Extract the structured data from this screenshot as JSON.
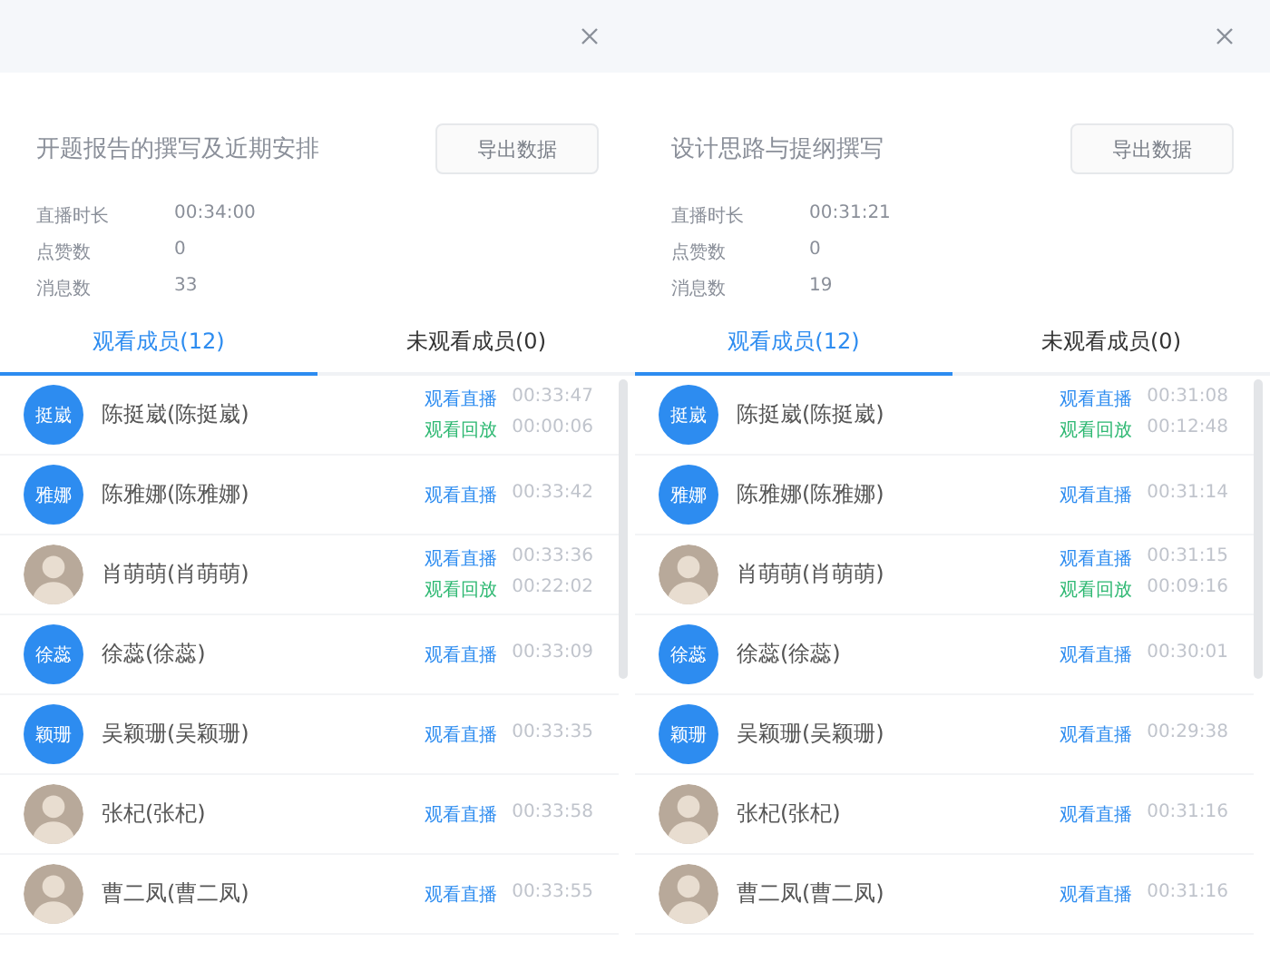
{
  "panels": [
    {
      "title": "开题报告的撰写及近期安排",
      "export_button": "导出数据",
      "stats": [
        {
          "label": "直播时长",
          "value": "00:34:00"
        },
        {
          "label": "点赞数",
          "value": "0"
        },
        {
          "label": "消息数",
          "value": "33"
        }
      ],
      "tabs": [
        {
          "label": "观看成员(12)",
          "selected": true
        },
        {
          "label": "未观看成员(0)",
          "selected": false
        }
      ],
      "members": [
        {
          "avatar": {
            "kind": "text",
            "text": "挺崴"
          },
          "name": "陈挺崴(陈挺崴)",
          "records": [
            {
              "kind": "live",
              "label": "观看直播",
              "time": "00:33:47"
            },
            {
              "kind": "replay",
              "label": "观看回放",
              "time": "00:00:06"
            }
          ]
        },
        {
          "avatar": {
            "kind": "text",
            "text": "雅娜"
          },
          "name": "陈雅娜(陈雅娜)",
          "records": [
            {
              "kind": "live",
              "label": "观看直播",
              "time": "00:33:42"
            }
          ]
        },
        {
          "avatar": {
            "kind": "photo"
          },
          "name": "肖萌萌(肖萌萌)",
          "records": [
            {
              "kind": "live",
              "label": "观看直播",
              "time": "00:33:36"
            },
            {
              "kind": "replay",
              "label": "观看回放",
              "time": "00:22:02"
            }
          ]
        },
        {
          "avatar": {
            "kind": "text",
            "text": "徐蕊"
          },
          "name": "徐蕊(徐蕊)",
          "records": [
            {
              "kind": "live",
              "label": "观看直播",
              "time": "00:33:09"
            }
          ]
        },
        {
          "avatar": {
            "kind": "text",
            "text": "颖珊"
          },
          "name": "吴颖珊(吴颖珊)",
          "records": [
            {
              "kind": "live",
              "label": "观看直播",
              "time": "00:33:35"
            }
          ]
        },
        {
          "avatar": {
            "kind": "photo"
          },
          "name": "张杞(张杞)",
          "records": [
            {
              "kind": "live",
              "label": "观看直播",
              "time": "00:33:58"
            }
          ]
        },
        {
          "avatar": {
            "kind": "photo"
          },
          "name": "曹二凤(曹二凤)",
          "records": [
            {
              "kind": "live",
              "label": "观看直播",
              "time": "00:33:55"
            }
          ]
        }
      ]
    },
    {
      "title": "设计思路与提纲撰写",
      "export_button": "导出数据",
      "stats": [
        {
          "label": "直播时长",
          "value": "00:31:21"
        },
        {
          "label": "点赞数",
          "value": "0"
        },
        {
          "label": "消息数",
          "value": "19"
        }
      ],
      "tabs": [
        {
          "label": "观看成员(12)",
          "selected": true
        },
        {
          "label": "未观看成员(0)",
          "selected": false
        }
      ],
      "members": [
        {
          "avatar": {
            "kind": "text",
            "text": "挺崴"
          },
          "name": "陈挺崴(陈挺崴)",
          "records": [
            {
              "kind": "live",
              "label": "观看直播",
              "time": "00:31:08"
            },
            {
              "kind": "replay",
              "label": "观看回放",
              "time": "00:12:48"
            }
          ]
        },
        {
          "avatar": {
            "kind": "text",
            "text": "雅娜"
          },
          "name": "陈雅娜(陈雅娜)",
          "records": [
            {
              "kind": "live",
              "label": "观看直播",
              "time": "00:31:14"
            }
          ]
        },
        {
          "avatar": {
            "kind": "photo"
          },
          "name": "肖萌萌(肖萌萌)",
          "records": [
            {
              "kind": "live",
              "label": "观看直播",
              "time": "00:31:15"
            },
            {
              "kind": "replay",
              "label": "观看回放",
              "time": "00:09:16"
            }
          ]
        },
        {
          "avatar": {
            "kind": "text",
            "text": "徐蕊"
          },
          "name": "徐蕊(徐蕊)",
          "records": [
            {
              "kind": "live",
              "label": "观看直播",
              "time": "00:30:01"
            }
          ]
        },
        {
          "avatar": {
            "kind": "text",
            "text": "颖珊"
          },
          "name": "吴颖珊(吴颖珊)",
          "records": [
            {
              "kind": "live",
              "label": "观看直播",
              "time": "00:29:38"
            }
          ]
        },
        {
          "avatar": {
            "kind": "photo"
          },
          "name": "张杞(张杞)",
          "records": [
            {
              "kind": "live",
              "label": "观看直播",
              "time": "00:31:16"
            }
          ]
        },
        {
          "avatar": {
            "kind": "photo"
          },
          "name": "曹二凤(曹二凤)",
          "records": [
            {
              "kind": "live",
              "label": "观看直播",
              "time": "00:31:16"
            }
          ]
        }
      ]
    }
  ]
}
